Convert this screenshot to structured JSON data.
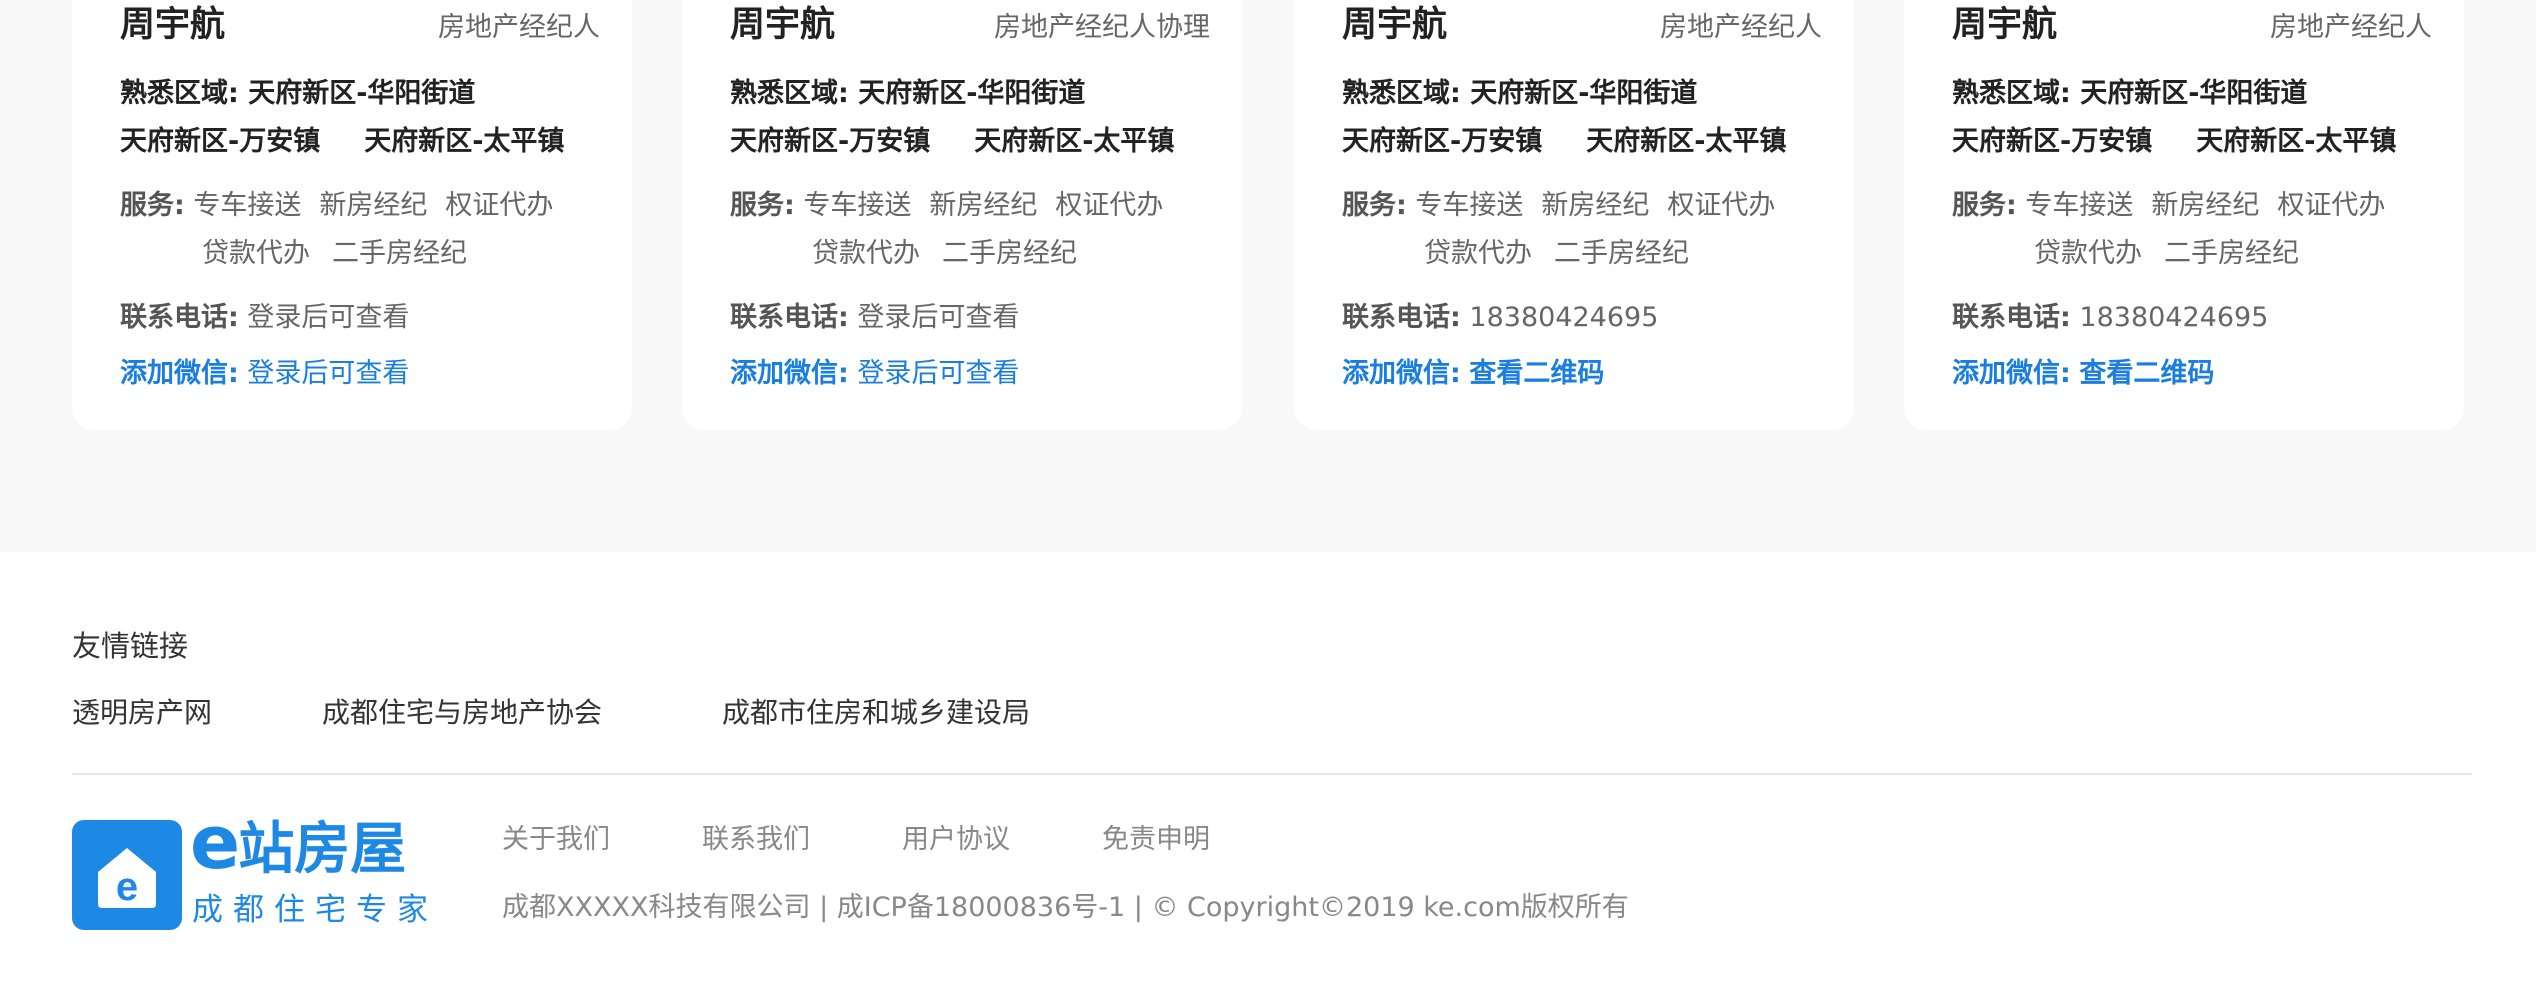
{
  "agents": [
    {
      "name": "周宇航",
      "role": "房地产经纪人",
      "area_label": "熟悉区域:",
      "area_main": "天府新区-华阳街道",
      "area_extra": [
        "天府新区-万安镇",
        "天府新区-太平镇"
      ],
      "service_label": "服务:",
      "services_line1": [
        "专车接送",
        "新房经纪",
        "权证代办"
      ],
      "services_line2": [
        "贷款代办",
        "二手房经纪"
      ],
      "phone_label": "联系电话:",
      "phone_value": "登录后可查看",
      "wechat_label": "添加微信:",
      "wechat_value": "登录后可查看"
    },
    {
      "name": "周宇航",
      "role": "房地产经纪人协理",
      "area_label": "熟悉区域:",
      "area_main": "天府新区-华阳街道",
      "area_extra": [
        "天府新区-万安镇",
        "天府新区-太平镇"
      ],
      "service_label": "服务:",
      "services_line1": [
        "专车接送",
        "新房经纪",
        "权证代办"
      ],
      "services_line2": [
        "贷款代办",
        "二手房经纪"
      ],
      "phone_label": "联系电话:",
      "phone_value": "登录后可查看",
      "wechat_label": "添加微信:",
      "wechat_value": "登录后可查看"
    },
    {
      "name": "周宇航",
      "role": "房地产经纪人",
      "area_label": "熟悉区域:",
      "area_main": "天府新区-华阳街道",
      "area_extra": [
        "天府新区-万安镇",
        "天府新区-太平镇"
      ],
      "service_label": "服务:",
      "services_line1": [
        "专车接送",
        "新房经纪",
        "权证代办"
      ],
      "services_line2": [
        "贷款代办",
        "二手房经纪"
      ],
      "phone_label": "联系电话:",
      "phone_value": "18380424695",
      "wechat_label": "添加微信:",
      "wechat_value": "查看二维码"
    },
    {
      "name": "周宇航",
      "role": "房地产经纪人",
      "area_label": "熟悉区域:",
      "area_main": "天府新区-华阳街道",
      "area_extra": [
        "天府新区-万安镇",
        "天府新区-太平镇"
      ],
      "service_label": "服务:",
      "services_line1": [
        "专车接送",
        "新房经纪",
        "权证代办"
      ],
      "services_line2": [
        "贷款代办",
        "二手房经纪"
      ],
      "phone_label": "联系电话:",
      "phone_value": "18380424695",
      "wechat_label": "添加微信:",
      "wechat_value": "查看二维码"
    }
  ],
  "friend_links": {
    "title": "友情链接",
    "links": [
      "透明房产网",
      "成都住宅与房地产协会",
      "成都市住房和城乡建设局"
    ]
  },
  "footer": {
    "logo_letter": "e",
    "logo_main": "站房屋",
    "logo_sub": "成都住宅专家",
    "nav": [
      "关于我们",
      "联系我们",
      "用户协议",
      "免责申明"
    ],
    "copyright": "成都XXXXX科技有限公司 | 成ICP备18000836号-1 | © Copyright©2019 ke.com版权所有"
  },
  "colors": {
    "accent": "#1e88e5",
    "link": "#1a7ee0",
    "background_top": "#f8f8f8"
  }
}
